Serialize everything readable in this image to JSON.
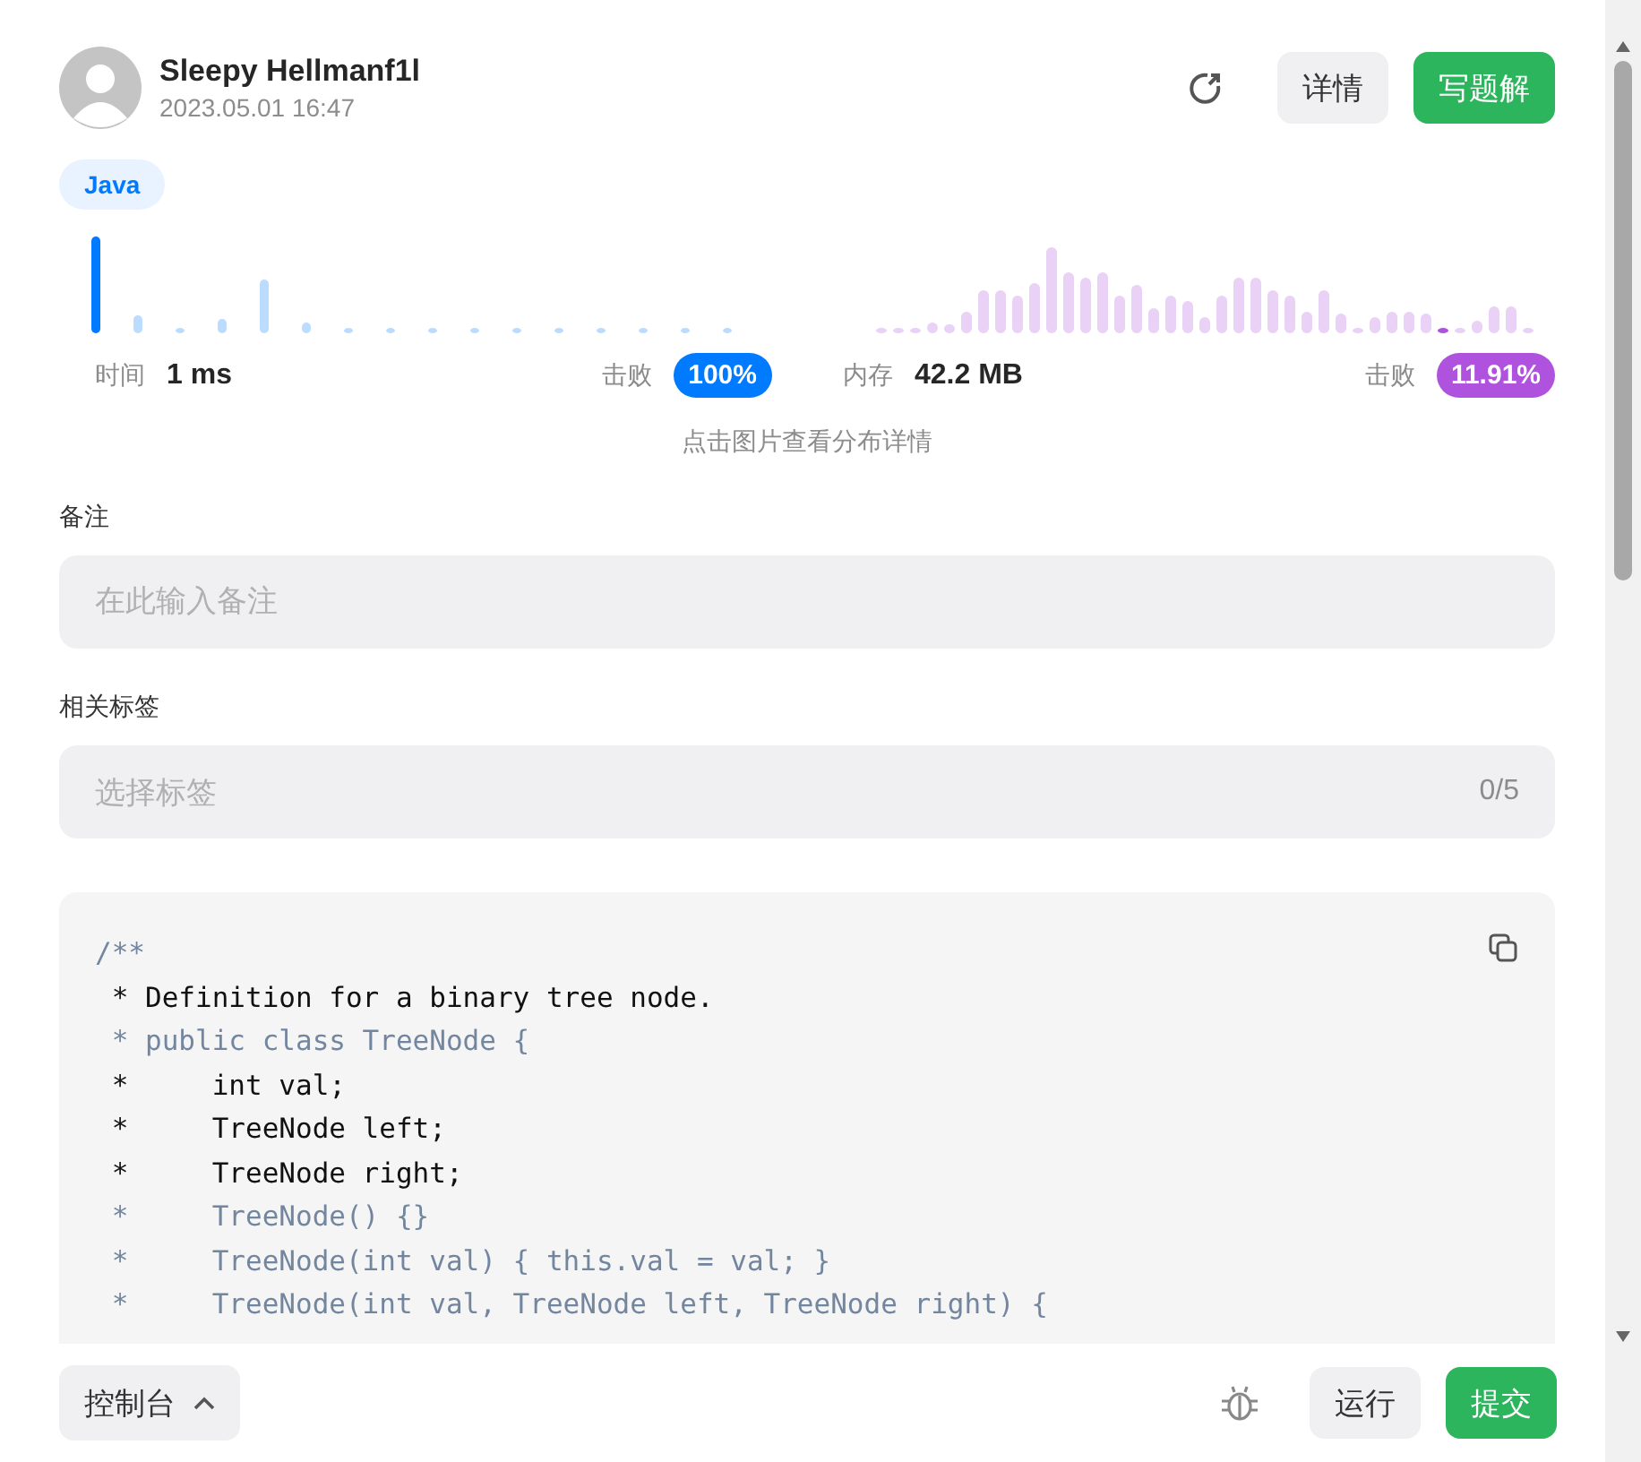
{
  "header": {
    "user_name": "Sleepy Hellmanf1l",
    "timestamp": "2023.05.01 16:47",
    "buttons": [
      {
        "label": "详情",
        "kind": "secondary"
      },
      {
        "label": "写题解",
        "kind": "primary"
      }
    ]
  },
  "language_tag": "Java",
  "stats": [
    {
      "label": "时间",
      "value": "1 ms",
      "beats_label": "击败",
      "beats": "100%",
      "color": "#007aff"
    },
    {
      "label": "内存",
      "value": "42.2 MB",
      "beats_label": "击败",
      "beats": "11.91%",
      "color": "#af52de"
    }
  ],
  "chart_hint": "点击图片查看分布详情",
  "note": {
    "label": "备注",
    "placeholder": "在此输入备注"
  },
  "tags": {
    "label": "相关标签",
    "placeholder": "选择标签",
    "count": "0/5"
  },
  "code_lines": [
    {
      "text": "/**",
      "dim": true
    },
    {
      "text": " * Definition for a binary tree node.",
      "dim": false
    },
    {
      "text": " * public class TreeNode {",
      "dim": true
    },
    {
      "text": " *     int val;",
      "dim": false
    },
    {
      "text": " *     TreeNode left;",
      "dim": false
    },
    {
      "text": " *     TreeNode right;",
      "dim": false
    },
    {
      "text": " *     TreeNode() {}",
      "dim": true
    },
    {
      "text": " *     TreeNode(int val) { this.val = val; }",
      "dim": true
    },
    {
      "text": " *     TreeNode(int val, TreeNode left, TreeNode right) {",
      "dim": true
    }
  ],
  "footer": {
    "console": "控制台",
    "buttons": [
      {
        "label": "运行",
        "kind": "secondary"
      },
      {
        "label": "提交",
        "kind": "primary"
      }
    ]
  }
}
